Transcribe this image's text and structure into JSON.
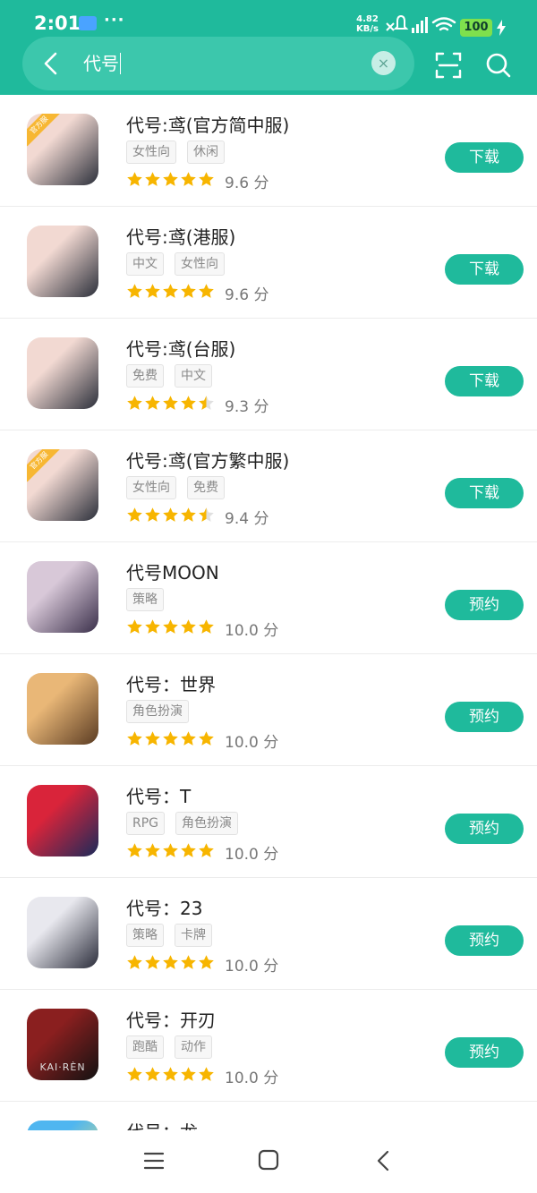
{
  "status_bar": {
    "time": "2:01",
    "more": "···",
    "speed_value": "4.82",
    "speed_unit": "KB/s",
    "battery": "100"
  },
  "search": {
    "query": "代号",
    "clear_symbol": "×"
  },
  "apps": [
    {
      "name": "代号:鸢(官方简中服)",
      "tags": [
        "女性向",
        "休闲"
      ],
      "score": "9.6 分",
      "stars": 5,
      "action": "下载",
      "badge": "官方服",
      "colors": [
        "#f2d9d2",
        "#2b2f3a"
      ]
    },
    {
      "name": "代号:鸢(港服)",
      "tags": [
        "中文",
        "女性向"
      ],
      "score": "9.6 分",
      "stars": 5,
      "action": "下载",
      "badge": "",
      "colors": [
        "#f2d9d2",
        "#2b2f3a"
      ]
    },
    {
      "name": "代号:鸢(台服)",
      "tags": [
        "免费",
        "中文"
      ],
      "score": "9.3 分",
      "stars": 4.5,
      "action": "下载",
      "badge": "",
      "colors": [
        "#f2d9d2",
        "#2b2f3a"
      ]
    },
    {
      "name": "代号:鸢(官方繁中服)",
      "tags": [
        "女性向",
        "免费"
      ],
      "score": "9.4 分",
      "stars": 4.5,
      "action": "下载",
      "badge": "官方服",
      "colors": [
        "#f2d9d2",
        "#2b2f3a"
      ]
    },
    {
      "name": "代号MOON",
      "tags": [
        "策略"
      ],
      "score": "10.0 分",
      "stars": 5,
      "action": "预约",
      "badge": "",
      "colors": [
        "#d8c8d8",
        "#3a2f4a"
      ]
    },
    {
      "name": "代号：世界",
      "tags": [
        "角色扮演"
      ],
      "score": "10.0 分",
      "stars": 5,
      "action": "预约",
      "badge": "",
      "colors": [
        "#e9b777",
        "#5a3b22"
      ]
    },
    {
      "name": "代号：T",
      "tags": [
        "RPG",
        "角色扮演"
      ],
      "score": "10.0 分",
      "stars": 5,
      "action": "预约",
      "badge": "",
      "colors": [
        "#d9243a",
        "#1b2a5a"
      ]
    },
    {
      "name": "代号：23",
      "tags": [
        "策略",
        "卡牌"
      ],
      "score": "10.0 分",
      "stars": 5,
      "action": "预约",
      "badge": "",
      "colors": [
        "#e8e8ee",
        "#2a2c3a"
      ]
    },
    {
      "name": "代号：开刃",
      "tags": [
        "跑酷",
        "动作"
      ],
      "score": "10.0 分",
      "stars": 5,
      "action": "预约",
      "badge": "",
      "colors": [
        "#8a1f1f",
        "#121212"
      ],
      "icon_text": "KAI·RÈN"
    },
    {
      "name": "代号：龙",
      "tags": [],
      "score": "",
      "stars": 0,
      "action": "",
      "badge": "",
      "colors": [
        "#4fb6f0",
        "#f5e36a"
      ]
    }
  ],
  "colors": {
    "accent": "#1fba9c",
    "star": "#f7b500",
    "star_empty": "#e0e0e0"
  }
}
